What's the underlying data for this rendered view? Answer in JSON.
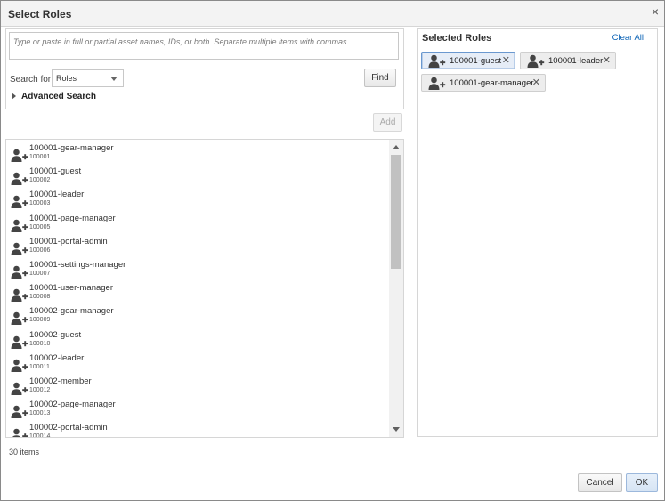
{
  "dialog": {
    "title": "Select Roles",
    "close_glyph": "×"
  },
  "search": {
    "placeholder": "Type or paste in full or partial asset names, IDs, or both. Separate multiple items with commas.",
    "search_for_label": "Search for",
    "search_for_value": "Roles",
    "find_label": "Find",
    "advanced_label": "Advanced Search",
    "add_label": "Add"
  },
  "results": {
    "items": [
      {
        "name": "100001-gear-manager",
        "id": "100001"
      },
      {
        "name": "100001-guest",
        "id": "100002"
      },
      {
        "name": "100001-leader",
        "id": "100003"
      },
      {
        "name": "100001-page-manager",
        "id": "100005"
      },
      {
        "name": "100001-portal-admin",
        "id": "100006"
      },
      {
        "name": "100001-settings-manager",
        "id": "100007"
      },
      {
        "name": "100001-user-manager",
        "id": "100008"
      },
      {
        "name": "100002-gear-manager",
        "id": "100009"
      },
      {
        "name": "100002-guest",
        "id": "100010"
      },
      {
        "name": "100002-leader",
        "id": "100011"
      },
      {
        "name": "100002-member",
        "id": "100012"
      },
      {
        "name": "100002-page-manager",
        "id": "100013"
      },
      {
        "name": "100002-portal-admin",
        "id": "100014"
      }
    ],
    "count_text": "30 items"
  },
  "selected": {
    "title": "Selected Roles",
    "clear_all": "Clear All",
    "chips": [
      {
        "label": "100001-guest",
        "remove": "✕"
      },
      {
        "label": "100001-leader",
        "remove": "✕"
      },
      {
        "label": "100001-gear-manager",
        "remove": "✕"
      }
    ]
  },
  "footer": {
    "cancel_label": "Cancel",
    "ok_label": "OK"
  },
  "icons": {
    "list_item": "add-user-icon",
    "chip": "add-user-icon",
    "advanced_toggle": "triangle-right-icon",
    "dropdown": "chevron-down-icon"
  },
  "colors": {
    "link": "#0b63b6",
    "focused_chip_border": "#6a98cf"
  }
}
